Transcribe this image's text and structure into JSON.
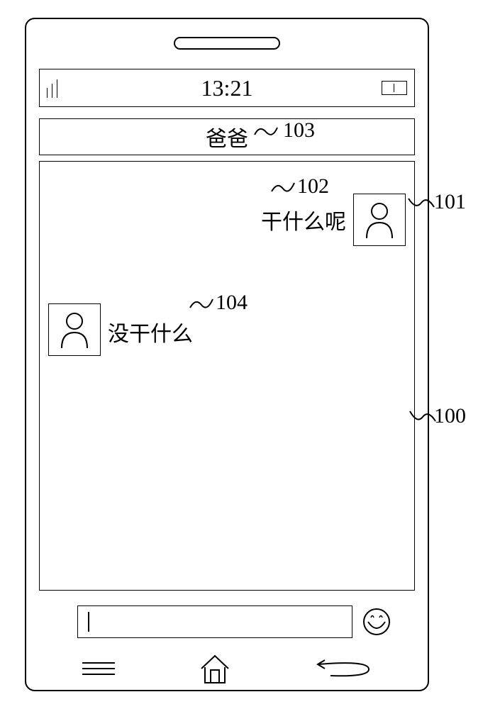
{
  "status_bar": {
    "time": "13:21"
  },
  "contact": {
    "name": "爸爸"
  },
  "messages": {
    "outgoing": "干什么呢",
    "incoming": "没干什么"
  },
  "annotations": {
    "ref_100": "100",
    "ref_101": "101",
    "ref_102": "102",
    "ref_103": "103",
    "ref_104": "104"
  }
}
